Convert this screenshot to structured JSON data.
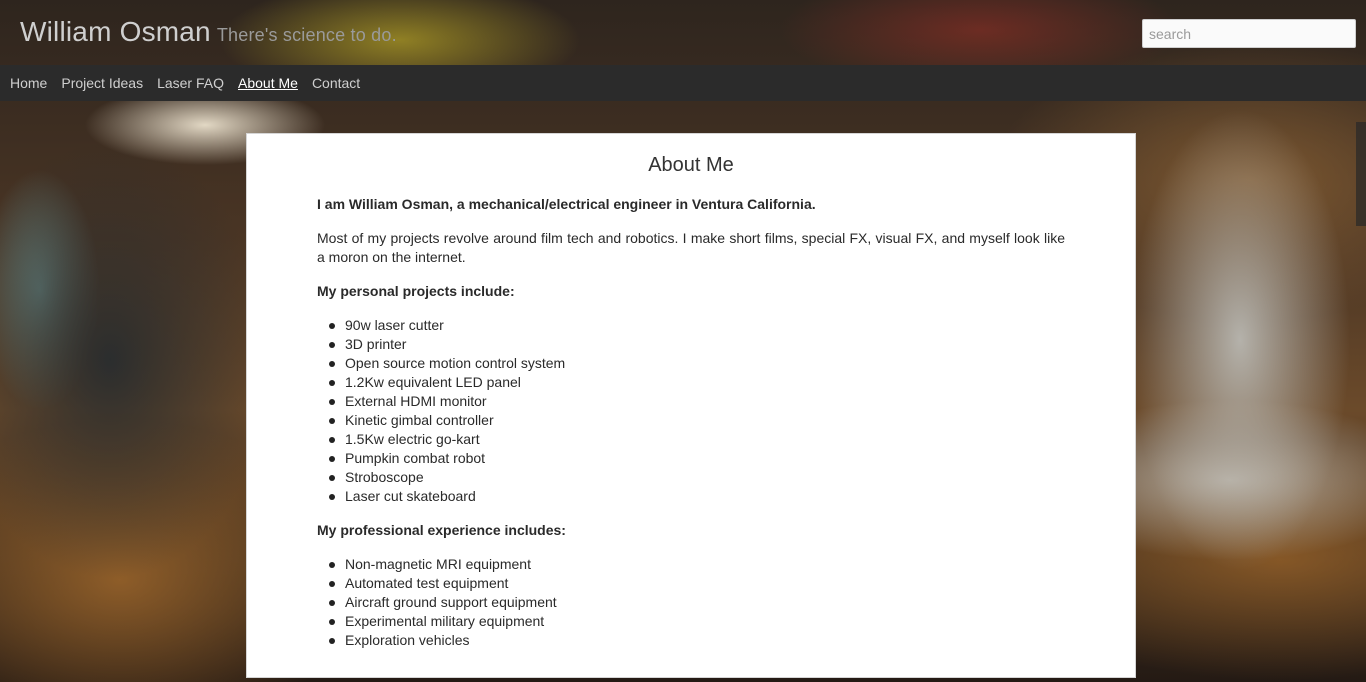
{
  "header": {
    "title": "William Osman",
    "tagline": "There's science to do.",
    "search_placeholder": "search"
  },
  "nav": {
    "items": [
      {
        "label": "Home"
      },
      {
        "label": "Project Ideas"
      },
      {
        "label": "Laser FAQ"
      },
      {
        "label": "About Me"
      },
      {
        "label": "Contact"
      }
    ],
    "active": "About Me"
  },
  "main": {
    "heading": "About Me",
    "intro": "I am William Osman, a mechanical/electrical engineer in Ventura California.",
    "paragraph": "Most of my projects revolve around film tech and robotics. I make short films, special FX, visual FX, and myself look like a moron on the internet.",
    "personal_heading": "My personal projects include:",
    "personal_projects": [
      "90w laser cutter",
      "3D printer",
      "Open source motion control system",
      "1.2Kw equivalent LED panel",
      "External HDMI monitor",
      "Kinetic gimbal controller",
      "1.5Kw electric go-kart",
      "Pumpkin combat robot",
      "Stroboscope",
      "Laser cut skateboard"
    ],
    "professional_heading": "My professional experience includes:",
    "professional_experience": [
      "Non-magnetic MRI equipment",
      "Automated test equipment",
      "Aircraft ground support equipment",
      "Experimental military equipment",
      "Exploration vehicles"
    ]
  }
}
